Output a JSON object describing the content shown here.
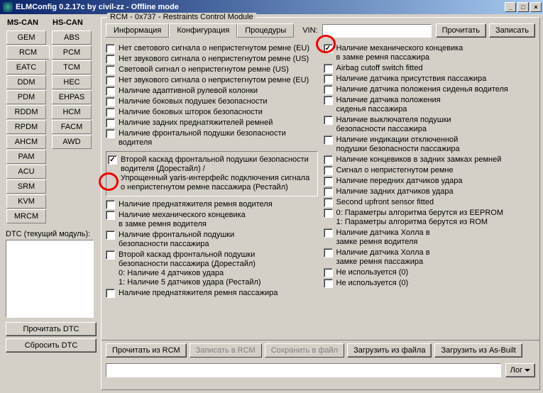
{
  "window": {
    "title": "ELMConfig 0.2.17c by civil-zz - Offline mode",
    "btn_min": "_",
    "btn_max": "□",
    "btn_close": "×"
  },
  "left_tabs": {
    "col1_label": "MS-CAN",
    "col2_label": "HS-CAN",
    "col1": [
      "GEM",
      "RCM",
      "EATC",
      "DDM",
      "PDM",
      "RDDM",
      "RPDM",
      "AHCM",
      "PAM",
      "ACU",
      "SRM",
      "KVM",
      "MRCM"
    ],
    "col2": [
      "ABS",
      "PCM",
      "TCM",
      "HEC",
      "EHPAS",
      "HCM",
      "FACM",
      "AWD"
    ]
  },
  "dtc": {
    "label": "DTC (текущий модуль):",
    "btn_read": "Прочитать DTC",
    "btn_reset": "Сбросить DTC"
  },
  "module": {
    "title": "RCM - 0x737 - Restraints Control Module",
    "tabs": [
      "Информация",
      "Конфигурация",
      "Процедуры"
    ],
    "vin_label": "VIN:",
    "btn_read": "Прочитать",
    "btn_write": "Записать"
  },
  "config": {
    "left": [
      {
        "label": "Нет светового сигнала о непристегнутом ремне (EU)",
        "checked": false
      },
      {
        "label": "Нет звукового сигнала о непристегнутом ремне (US)",
        "checked": false
      },
      {
        "label": "Световой сигнал о непристегнутом ремне (US)",
        "checked": false
      },
      {
        "label": "Нет звукового сигнала о непристегнутом ремне (EU)",
        "checked": false
      },
      {
        "label": "Наличие адаптивной рулевой колонки",
        "checked": false
      },
      {
        "label": "Наличие боковых подушек безопасности",
        "checked": false
      },
      {
        "label": "Наличие боковых шторок безопасности",
        "checked": false
      },
      {
        "label": "Наличие задних преднатяжителей ремней",
        "checked": false
      },
      {
        "label": "Наличие фронтальной подушки безопасности водителя",
        "checked": false
      }
    ],
    "left_group": {
      "label": "Второй каскад фронтальной подушки безопасности водителя (Дорестайл) /\nУпрощенный yaris-интерфейс подключения сигнала о непристегнутом ремне пассажира (Рестайл)",
      "checked": true
    },
    "left2": [
      {
        "label": "Наличие преднатяжителя ремня водителя",
        "checked": false
      },
      {
        "label": "Наличие механического концевика\nв замке ремня водителя",
        "checked": false
      },
      {
        "label": "Наличие фронтальной подушки\nбезопасности пассажира",
        "checked": false
      },
      {
        "label": "Второй каскад фронтальной подушки\nбезопасности пассажира (Дорестайл)\n0: Наличие 4 датчиков удара\n1: Наличие 5 датчиков удара (Рестайл)",
        "checked": false
      },
      {
        "label": "Наличие преднатяжителя ремня пассажира",
        "checked": false
      }
    ],
    "right": [
      {
        "label": "Наличие механического концевика\nв замке ремня пассажира",
        "checked": true
      },
      {
        "label": "Airbag cutoff switch fitted",
        "checked": false
      },
      {
        "label": "Наличие датчика присутствия пассажира",
        "checked": false
      },
      {
        "label": "Наличие датчика положения сиденья водителя",
        "checked": false
      },
      {
        "label": "Наличие датчика положения\nсиденья пассажира",
        "checked": false
      },
      {
        "label": "Наличие выключателя подушки\nбезопасности пассажира",
        "checked": false
      },
      {
        "label": "Наличие индикации отключенной\nподушки безопасности пассажира",
        "checked": false
      },
      {
        "label": "Наличие концевиков в задних замках ремней",
        "checked": false
      },
      {
        "label": "Сигнал о непристегнутом ремне",
        "checked": false
      },
      {
        "label": "Наличие передних датчиков удара",
        "checked": false
      },
      {
        "label": "Наличие задних датчиков удара",
        "checked": false
      },
      {
        "label": "Second upfront sensor fitted",
        "checked": false
      },
      {
        "label": "0: Параметры алгоритма берутся из EEPROM\n1: Параметры алгоритма берутся из ROM",
        "checked": false
      },
      {
        "label": "Наличие датчика Холла в\nзамке ремня водителя",
        "checked": false
      },
      {
        "label": "Наличие датчика Холла в\nзамке ремня пассажира",
        "checked": false
      },
      {
        "label": "Не используется (0)",
        "checked": false
      },
      {
        "label": "Не используется (0)",
        "checked": false
      }
    ]
  },
  "bottom_buttons": {
    "b1": "Прочитать из RCM",
    "b2": "Записать в RCM",
    "b3": "Сохранить в файл",
    "b4": "Загрузить из файла",
    "b5": "Загрузить из As-Built"
  },
  "footer": {
    "log": "Лог"
  }
}
